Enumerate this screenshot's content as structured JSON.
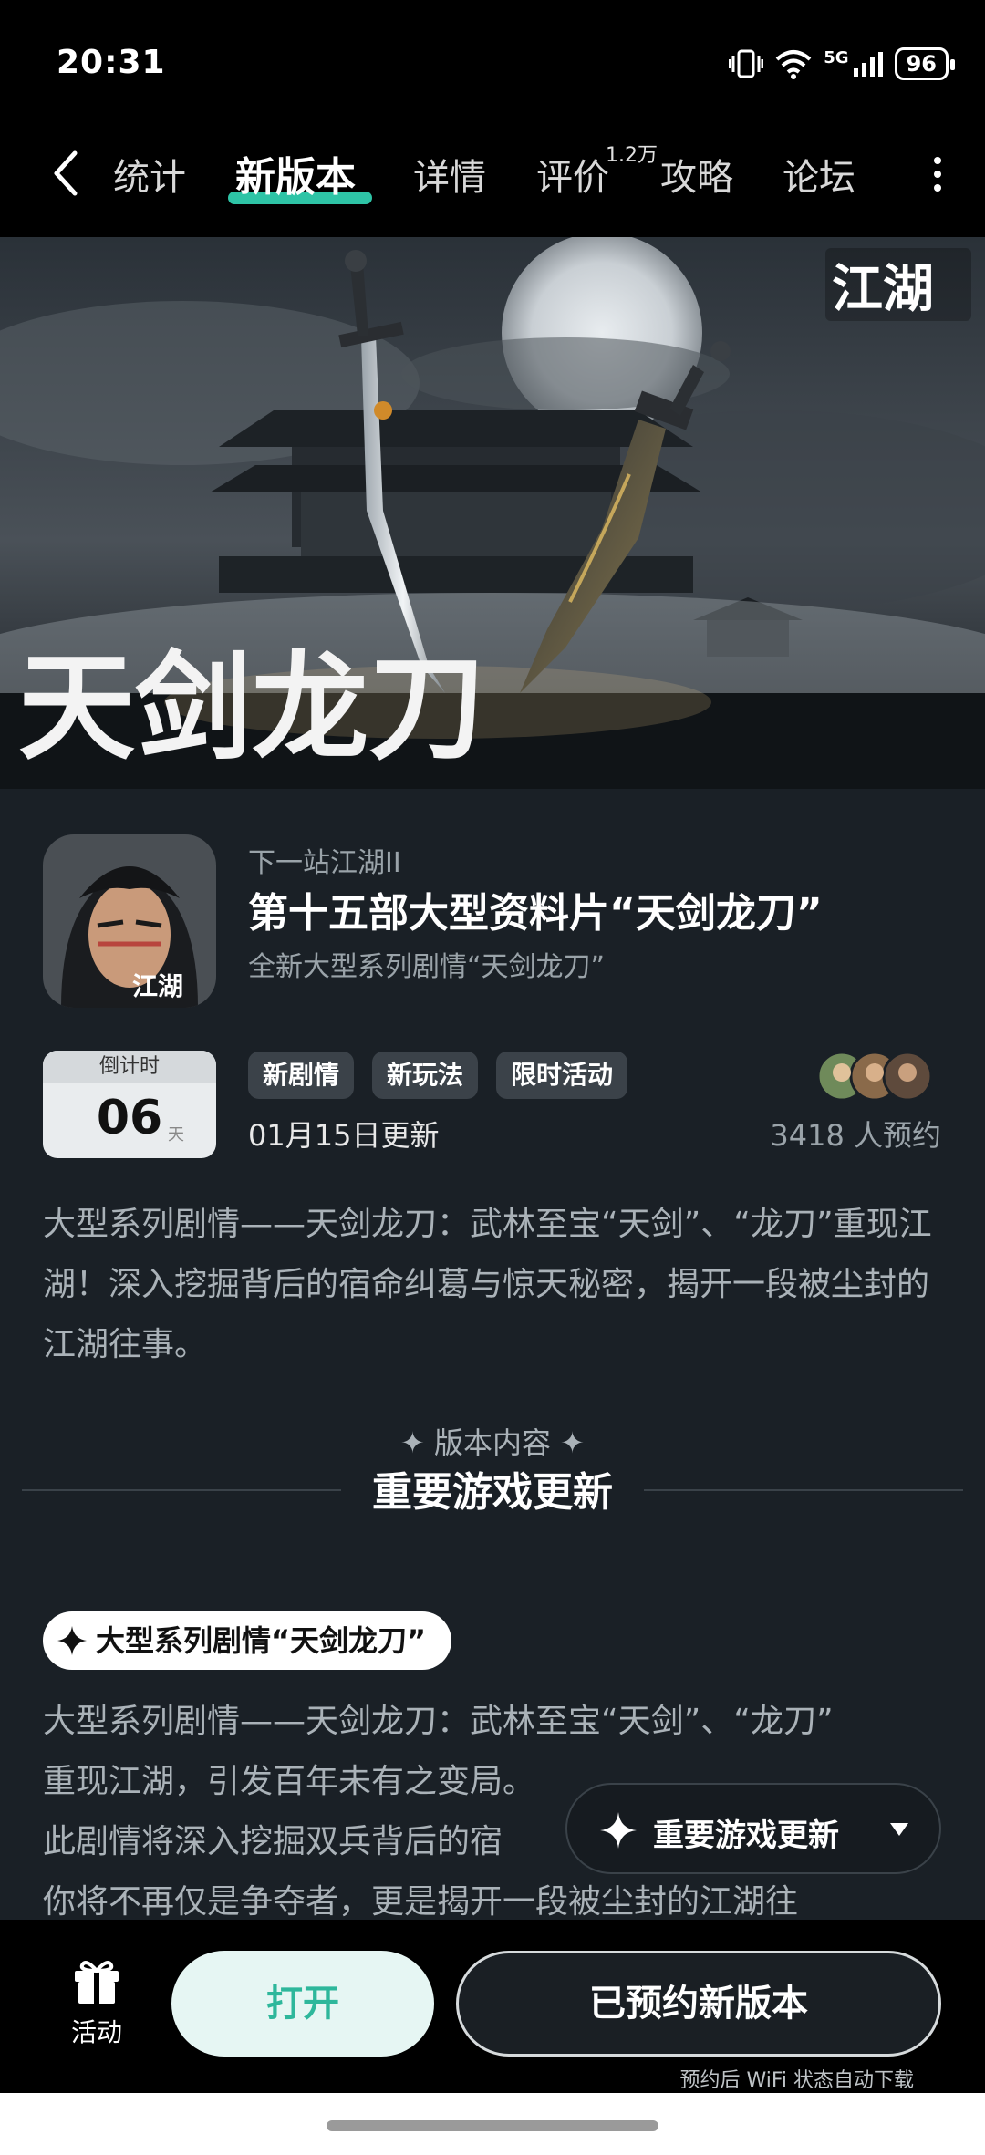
{
  "status_bar": {
    "time": "20:31",
    "network": "5G",
    "battery": "96"
  },
  "nav": {
    "tabs": [
      {
        "label": "统计"
      },
      {
        "label": "新版本"
      },
      {
        "label": "详情"
      },
      {
        "label": "评价"
      },
      {
        "label": "攻略"
      },
      {
        "label": "论坛"
      }
    ],
    "active_tab": "新版本",
    "review_badge": "1.2万"
  },
  "hero": {
    "title_art": "天剑龙刀",
    "logo_text": "江湖"
  },
  "game": {
    "name": "下一站江湖II",
    "icon_logo_text": "江湖",
    "update_title": "第十五部大型资料片“天剑龙刀”",
    "update_subtitle": "全新大型系列剧情“天剑龙刀”"
  },
  "countdown": {
    "label": "倒计时",
    "value": "06",
    "unit": "天"
  },
  "tags": [
    "新剧情",
    "新玩法",
    "限时活动"
  ],
  "update_date": "01月15日更新",
  "reserve_count": "3418 人预约",
  "description": "大型系列剧情——天剑龙刀：武林至宝“天剑”、“龙刀”重现江湖！深入挖掘背后的宿命纠葛与惊天秘密，揭开一段被尘封的江湖往事。",
  "section": {
    "subtitle": "✦ 版本内容 ✦",
    "title": "重要游戏更新"
  },
  "feature": {
    "pill_label": "大型系列剧情“天剑龙刀”",
    "text_line1": "大型系列剧情——天剑龙刀：武林至宝“天剑”、“龙刀”",
    "text_line2": "重现江湖，引发百年未有之变局。",
    "text_line3": "此剧情将深入挖掘双兵背后的宿",
    "text_line4": "你将不再仅是争夺者，更是揭开一段被尘封的江湖往"
  },
  "floating_button": {
    "label": "重要游戏更新"
  },
  "bottom_bar": {
    "activity_label": "活动",
    "open_label": "打开",
    "reserve_label": "已预约新版本",
    "wifi_note": "预约后 WiFi 状态自动下载"
  },
  "colors": {
    "accent": "#2ec4a6",
    "content_bg": "#1a2026",
    "open_button_bg": "#e6f6f3"
  }
}
